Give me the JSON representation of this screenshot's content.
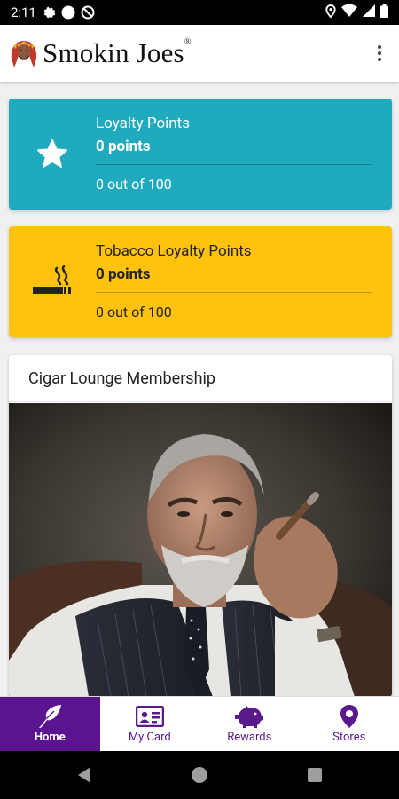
{
  "status_bar": {
    "time": "2:11",
    "icons_left": [
      "gear-icon",
      "circle-icon",
      "do-not-disturb-icon"
    ],
    "icons_right": [
      "location-icon",
      "wifi-icon",
      "signal-icon",
      "battery-icon"
    ]
  },
  "app_bar": {
    "brand": "Smokin Joes",
    "trademark": "®",
    "overflow_icon": "more-vert-icon"
  },
  "loyalty_card": {
    "title": "Loyalty Points",
    "points": "0 points",
    "progress": "0 out of 100",
    "progress_value": 0,
    "progress_max": 100,
    "icon": "star-icon",
    "color": "#1faabd"
  },
  "tobacco_card": {
    "title": "Tobacco Loyalty Points",
    "points": "0 points",
    "progress": "0 out of 100",
    "progress_value": 0,
    "progress_max": 100,
    "icon": "smoking-icon",
    "color": "#ffc20e"
  },
  "membership_card": {
    "title": "Cigar Lounge Membership",
    "image": "man-with-cigar-photo"
  },
  "bottom_nav": {
    "items": [
      {
        "label": "Home",
        "icon": "feather-icon",
        "active": true
      },
      {
        "label": "My Card",
        "icon": "id-card-icon",
        "active": false
      },
      {
        "label": "Rewards",
        "icon": "piggy-bank-icon",
        "active": false
      },
      {
        "label": "Stores",
        "icon": "location-pin-icon",
        "active": false
      }
    ],
    "accent": "#5a1490"
  },
  "system_nav": {
    "buttons": [
      "back-icon",
      "home-icon",
      "recents-icon"
    ]
  }
}
